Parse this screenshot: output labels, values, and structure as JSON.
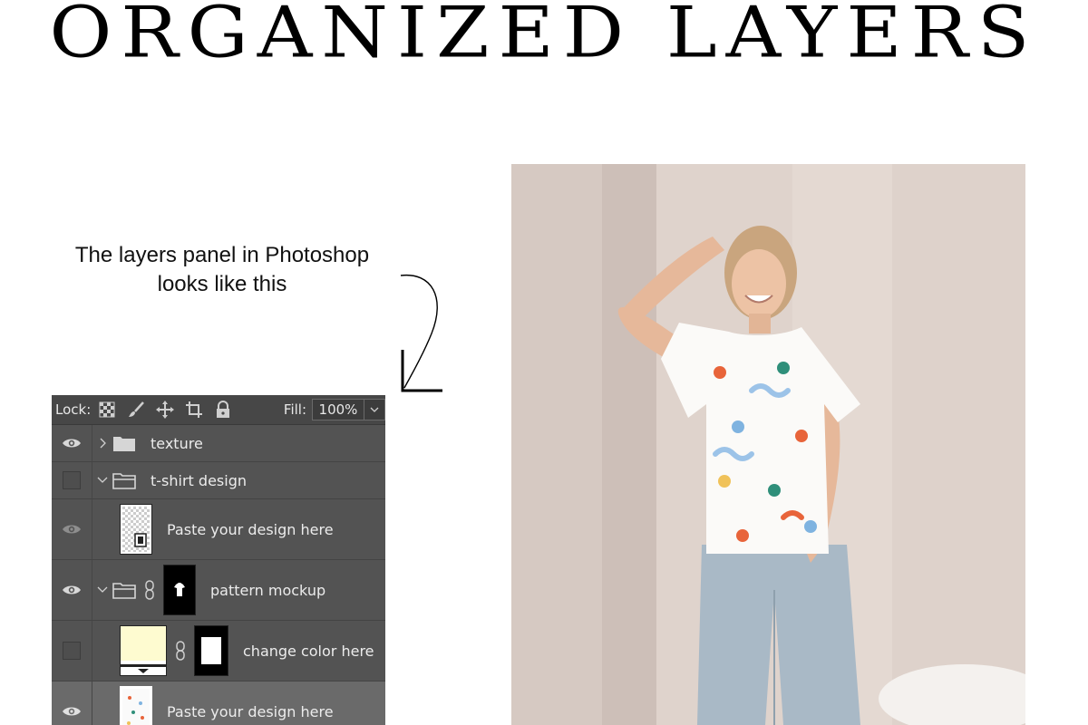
{
  "heading": "ORGANIZED LAYERS",
  "caption": {
    "line1": "The layers panel in Photoshop",
    "line2": "looks like this"
  },
  "panel": {
    "lock_label": "Lock:",
    "fill_label": "Fill:",
    "fill_value": "100%",
    "layers": [
      {
        "name": "texture",
        "visible": true,
        "type": "group-collapsed"
      },
      {
        "name": "t-shirt design",
        "visible": false,
        "type": "group-expanded"
      },
      {
        "name": "Paste your design here",
        "visible": true,
        "type": "smart-object"
      },
      {
        "name": "pattern mockup",
        "visible": true,
        "type": "group-masked"
      },
      {
        "name": "change color here",
        "visible": false,
        "type": "fill-layer",
        "swatch": "#fefbd0"
      },
      {
        "name": "Paste your design here",
        "visible": true,
        "type": "smart-object",
        "selected": true
      }
    ]
  },
  "colors": {
    "panel_bg": "#535353",
    "selected_row": "#6a6a6a",
    "swatch": "#fefbd0"
  }
}
